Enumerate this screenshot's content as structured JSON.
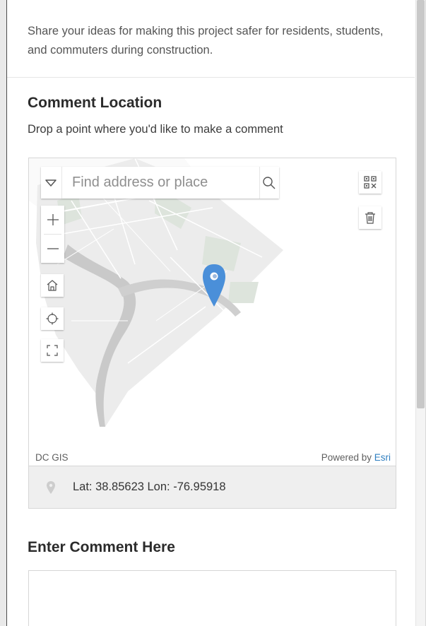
{
  "intro": {
    "text": "Share your ideas for making this project safer for residents, students, and commuters during construction."
  },
  "location": {
    "title": "Comment Location",
    "help": "Drop a point where you'd like to make a comment"
  },
  "map": {
    "search_placeholder": "Find address or place",
    "attribution_left": "DC GIS",
    "powered_by": "Powered by",
    "esri_link": "Esri",
    "pin_color": "#4a8fd9",
    "icons": {
      "search_toggle": "chevron-down-icon",
      "search": "search-icon",
      "zoom_in": "plus-icon",
      "zoom_out": "minus-icon",
      "home": "home-icon",
      "locate": "locate-icon",
      "fullscreen": "fullscreen-icon",
      "qr": "qr-code-icon",
      "delete": "trash-icon"
    }
  },
  "coordinates": {
    "text": "Lat: 38.85623  Lon: -76.95918"
  },
  "comment": {
    "title": "Enter Comment Here",
    "value": ""
  }
}
